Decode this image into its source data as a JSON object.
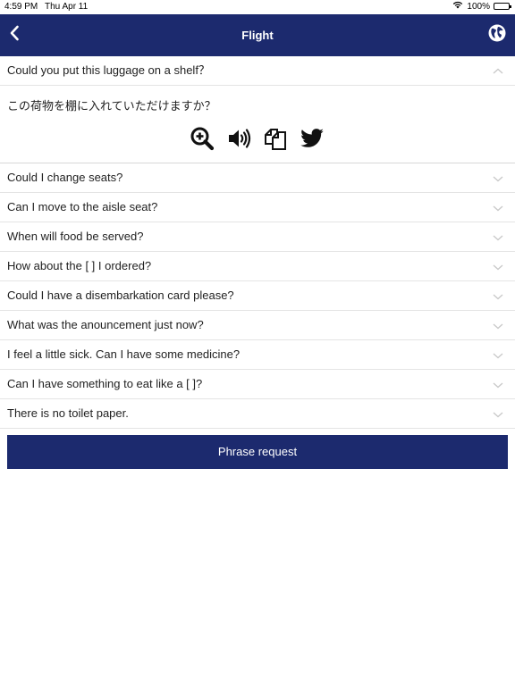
{
  "status_bar": {
    "time": "4:59 PM",
    "date": "Thu Apr 11",
    "battery": "100%",
    "battery_level": 1.0
  },
  "nav": {
    "title": "Flight",
    "back_icon": "chevron-left-icon",
    "globe_icon": "globe-icon"
  },
  "expanded_item": {
    "phrase": "Could you put this luggage on a shelf？",
    "translation": "この荷物を棚に入れていただけますか？",
    "actions": [
      "zoom-in-icon",
      "speaker-icon",
      "copy-icon",
      "twitter-icon"
    ]
  },
  "phrases": [
    "Could I change seats?",
    "Can I move to the aisle seat?",
    "When will food be served?",
    "How about the [ ] I ordered?",
    "Could I have a disembarkation card please?",
    "What was the anouncement just now?",
    "I feel a little sick. Can I have some medicine?",
    "Can I have something to eat like a [ ]?",
    "There is no toilet paper."
  ],
  "request_button": {
    "label": "Phrase request"
  },
  "colors": {
    "brand": "#1c2a6e",
    "divider": "#e4e4e4",
    "chevron": "#c8c8c8"
  }
}
